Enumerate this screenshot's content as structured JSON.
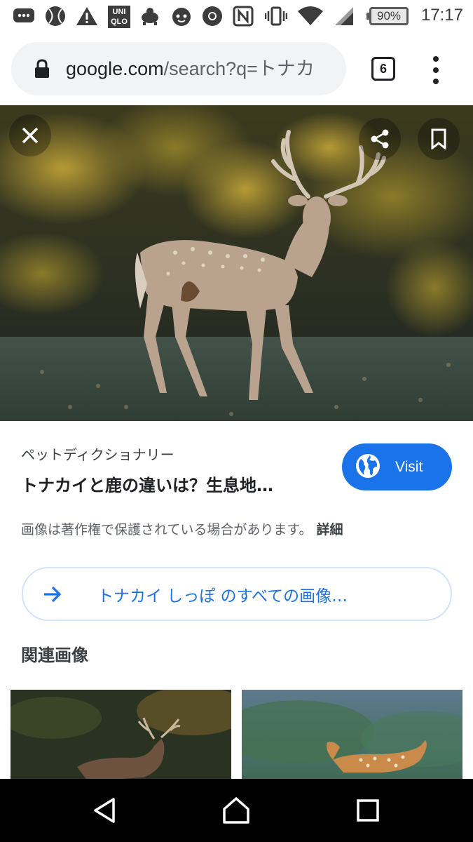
{
  "status_bar": {
    "time": "17:17",
    "battery": "90%",
    "uniqlo_label": "UNI\nQLO",
    "icons": [
      "messages-icon",
      "sports-ball-icon",
      "warning-icon",
      "uniqlo-icon",
      "turtle-icon",
      "character-icon",
      "chrome-icon",
      "nfc-icon",
      "vibrate-icon",
      "wifi-icon",
      "signal-icon",
      "battery-icon"
    ]
  },
  "browser": {
    "url_host": "google.com",
    "url_path": "/search?q=トナカ",
    "tab_count": "6"
  },
  "viewer": {
    "close_icon": "close-icon",
    "share_icon": "share-icon",
    "bookmark_icon": "bookmark-icon"
  },
  "result": {
    "source": "ペットディクショナリー",
    "title": "トナカイと鹿の違いは？生息地…",
    "visit_label": "Visit",
    "copyright": "画像は著作権で保護されている場合があります。",
    "details_label": "詳細"
  },
  "all_images_label": "トナカイ しっぽ のすべての画像…",
  "related_heading": "関連画像",
  "colors": {
    "accent": "#1a73e8",
    "url_bar_bg": "#f1f3f4",
    "nav_bar": "#000000"
  }
}
